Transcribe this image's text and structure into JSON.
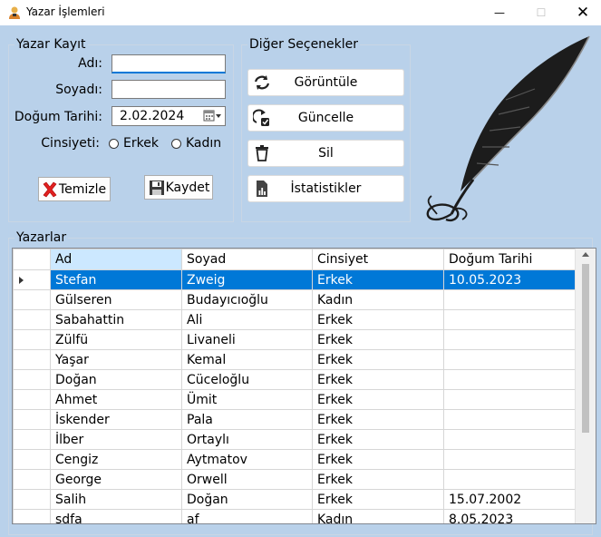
{
  "window": {
    "title": "Yazar İşlemleri",
    "minimize": "—",
    "maximize": "☐",
    "close": "✕"
  },
  "kayit": {
    "legend": "Yazar Kayıt",
    "ad_label": "Adı:",
    "ad_value": "",
    "soyad_label": "Soyadı:",
    "soyad_value": "",
    "dogum_label": "Doğum Tarihi:",
    "dogum_value": "2.02.2024",
    "cinsiyet_label": "Cinsiyeti:",
    "erkek": "Erkek",
    "kadin": "Kadın",
    "temizle": "Temizle",
    "kaydet": "Kaydet"
  },
  "secenekler": {
    "legend": "Diğer Seçenekler",
    "goruntule": "Görüntüle",
    "guncelle": "Güncelle",
    "sil": "Sil",
    "istatistikler": "İstatistikler"
  },
  "yazarlar": {
    "legend": "Yazarlar",
    "columns": [
      "Ad",
      "Soyad",
      "Cinsiyet",
      "Doğum Tarihi"
    ],
    "rows": [
      [
        "Stefan",
        "Zweig",
        "Erkek",
        "10.05.2023"
      ],
      [
        "Gülseren",
        "Budayıcıoğlu",
        "Kadın",
        ""
      ],
      [
        "Sabahattin",
        "Ali",
        "Erkek",
        ""
      ],
      [
        "Zülfü",
        "Livaneli",
        "Erkek",
        ""
      ],
      [
        "Yaşar",
        "Kemal",
        "Erkek",
        ""
      ],
      [
        "Doğan",
        "Cüceloğlu",
        "Erkek",
        ""
      ],
      [
        "Ahmet",
        "Ümit",
        "Erkek",
        ""
      ],
      [
        "İskender",
        "Pala",
        "Erkek",
        ""
      ],
      [
        "İlber",
        "Ortaylı",
        "Erkek",
        ""
      ],
      [
        "Cengiz",
        "Aytmatov",
        "Erkek",
        ""
      ],
      [
        "George",
        "Orwell",
        "Erkek",
        ""
      ],
      [
        "Salih",
        "Doğan",
        "Erkek",
        "15.07.2002"
      ],
      [
        "sdfa",
        "af",
        "Kadın",
        "8.05.2023"
      ]
    ]
  },
  "colors": {
    "form_bg": "#b9d1ea",
    "selection": "#0078d7",
    "header_selected": "#cce8ff"
  }
}
